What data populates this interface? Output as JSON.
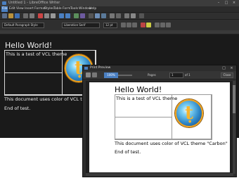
{
  "main_window": {
    "title": "Untitled 1 - LibreOffice Writer",
    "menus": [
      "File",
      "Edit",
      "View",
      "Insert",
      "Format",
      "Styles",
      "Table",
      "Form",
      "Tools",
      "Window",
      "Help"
    ],
    "paragraph_style": "Default Paragraph Style",
    "font_name": "Liberation Serif",
    "font_size": "12 pt",
    "doc": {
      "heading": "Hello World!",
      "cell_text": "This is a test of VCL theme",
      "body_line": "This document uses color of VCL theme \"Carbon\"",
      "end_line": "End of test."
    }
  },
  "preview_window": {
    "title": "Print Preview",
    "zoom": "100%",
    "pages_label": "Pages",
    "page_num": "1",
    "of_total": "of 1",
    "close_label": "Close",
    "doc": {
      "heading": "Hello World!",
      "cell_text": "This is a test of VCL theme",
      "body_line": "This document uses color of VCL theme \"Carbon\"",
      "end_line": "End of test."
    }
  },
  "colors": {
    "accent": "#4a7fc1",
    "dark_bg": "#2b2b2b",
    "logo_ring": "#f0a11c"
  },
  "icons": [
    "app-icon",
    "new-icon",
    "open-icon",
    "save-icon",
    "print-icon",
    "undo-icon",
    "redo-icon",
    "bold-icon",
    "italic-icon",
    "close-icon",
    "minimize-icon",
    "maximize-icon",
    "globe-logo"
  ]
}
